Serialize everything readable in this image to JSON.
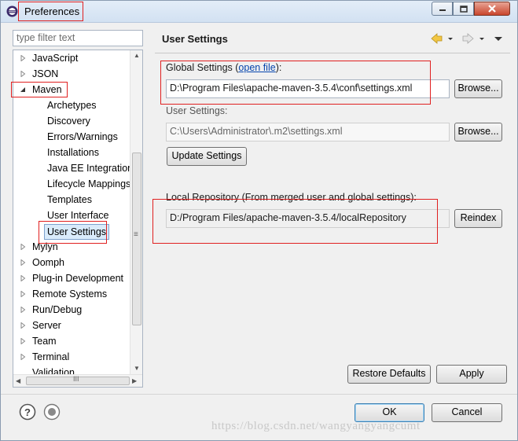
{
  "window": {
    "title": "Preferences",
    "icons": {
      "app": "eclipse-icon",
      "minimize": "minimize-icon",
      "maximize": "maximize-icon",
      "close": "close-icon"
    }
  },
  "sidebar": {
    "filter_placeholder": "type filter text",
    "items": [
      {
        "label": "JavaScript",
        "expanded": false,
        "level": 0
      },
      {
        "label": "JSON",
        "expanded": false,
        "level": 0
      },
      {
        "label": "Maven",
        "expanded": true,
        "level": 0
      },
      {
        "label": "Archetypes",
        "level": 1
      },
      {
        "label": "Discovery",
        "level": 1
      },
      {
        "label": "Errors/Warnings",
        "level": 1
      },
      {
        "label": "Installations",
        "level": 1
      },
      {
        "label": "Java EE Integration",
        "level": 1
      },
      {
        "label": "Lifecycle Mappings",
        "level": 1
      },
      {
        "label": "Templates",
        "level": 1
      },
      {
        "label": "User Interface",
        "level": 1
      },
      {
        "label": "User Settings",
        "level": 1,
        "selected": true
      },
      {
        "label": "Mylyn",
        "expanded": false,
        "level": 0
      },
      {
        "label": "Oomph",
        "expanded": false,
        "level": 0
      },
      {
        "label": "Plug-in Development",
        "expanded": false,
        "level": 0
      },
      {
        "label": "Remote Systems",
        "expanded": false,
        "level": 0
      },
      {
        "label": "Run/Debug",
        "expanded": false,
        "level": 0
      },
      {
        "label": "Server",
        "expanded": false,
        "level": 0
      },
      {
        "label": "Team",
        "expanded": false,
        "level": 0
      },
      {
        "label": "Terminal",
        "expanded": false,
        "level": 0
      },
      {
        "label": "Validation",
        "level": 0
      }
    ],
    "hscroll_grip": "III",
    "vscroll_grip": "≡"
  },
  "page": {
    "title": "User Settings",
    "global": {
      "label_prefix": "Global Settings (",
      "link": "open file",
      "label_suffix": "):",
      "value": "D:\\Program Files\\apache-maven-3.5.4\\conf\\settings.xml",
      "browse": "Browse..."
    },
    "user": {
      "label": "User Settings:",
      "value": "C:\\Users\\Administrator\\.m2\\settings.xml",
      "browse": "Browse..."
    },
    "update_button": "Update Settings",
    "local_repo": {
      "label": "Local Repository (From merged user and global settings):",
      "value": "D:/Program Files/apache-maven-3.5.4/localRepository",
      "reindex": "Reindex"
    },
    "restore_defaults": "Restore Defaults",
    "apply": "Apply"
  },
  "footer": {
    "ok": "OK",
    "cancel": "Cancel",
    "help_icon": "help-icon",
    "import_icon": "record-icon"
  },
  "watermark": "https://blog.csdn.net/wangyangyangcumt",
  "colors": {
    "highlight_box": "#e02020",
    "link": "#0645ad",
    "selection": "#d9ebfb"
  }
}
